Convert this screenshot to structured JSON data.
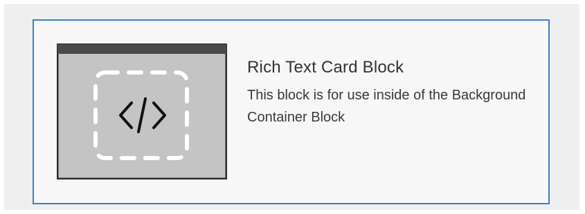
{
  "card": {
    "title": "Rich Text Card Block",
    "description": "This block is for use inside of the Background Container Block",
    "thumbnail_icon": "code-brackets-icon",
    "colors": {
      "selected_border": "#3b7bd6",
      "card_background": "#f7f7f7",
      "page_background": "#efefef",
      "thumbnail_frame": "#2b2b2b",
      "thumbnail_body": "#c4c4c4",
      "thumbnail_titlebar": "#4a4a4d"
    }
  }
}
